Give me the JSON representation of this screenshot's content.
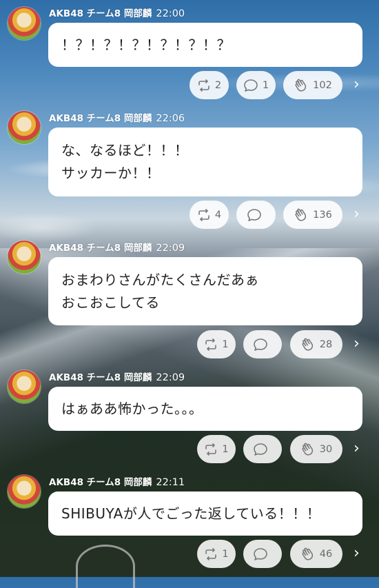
{
  "posts": [
    {
      "author": "AKB48 チーム8 岡部麟",
      "time": "22:00",
      "lines": [
        "！？！？！？！？！？！？"
      ],
      "retweets": "2",
      "comments": "1",
      "claps": "102"
    },
    {
      "author": "AKB48 チーム8 岡部麟",
      "time": "22:06",
      "lines": [
        "な、なるほど！！！",
        "サッカーか！！"
      ],
      "retweets": "4",
      "comments": "",
      "claps": "136"
    },
    {
      "author": "AKB48 チーム8 岡部麟",
      "time": "22:09",
      "lines": [
        "おまわりさんがたくさんだあぁ",
        "おこおこしてる"
      ],
      "retweets": "1",
      "comments": "",
      "claps": "28"
    },
    {
      "author": "AKB48 チーム8 岡部麟",
      "time": "22:09",
      "lines": [
        "はぁああ怖かった。。。"
      ],
      "retweets": "1",
      "comments": "",
      "claps": "30"
    },
    {
      "author": "AKB48 チーム8 岡部麟",
      "time": "22:11",
      "lines": [
        "SHIBUYAが人でごった返している！！！"
      ],
      "retweets": "1",
      "comments": "",
      "claps": "46"
    }
  ],
  "icons": {
    "retweet": "retweet-icon",
    "comment": "comment-icon",
    "clap": "clap-icon",
    "more": "chevron-right-icon"
  }
}
